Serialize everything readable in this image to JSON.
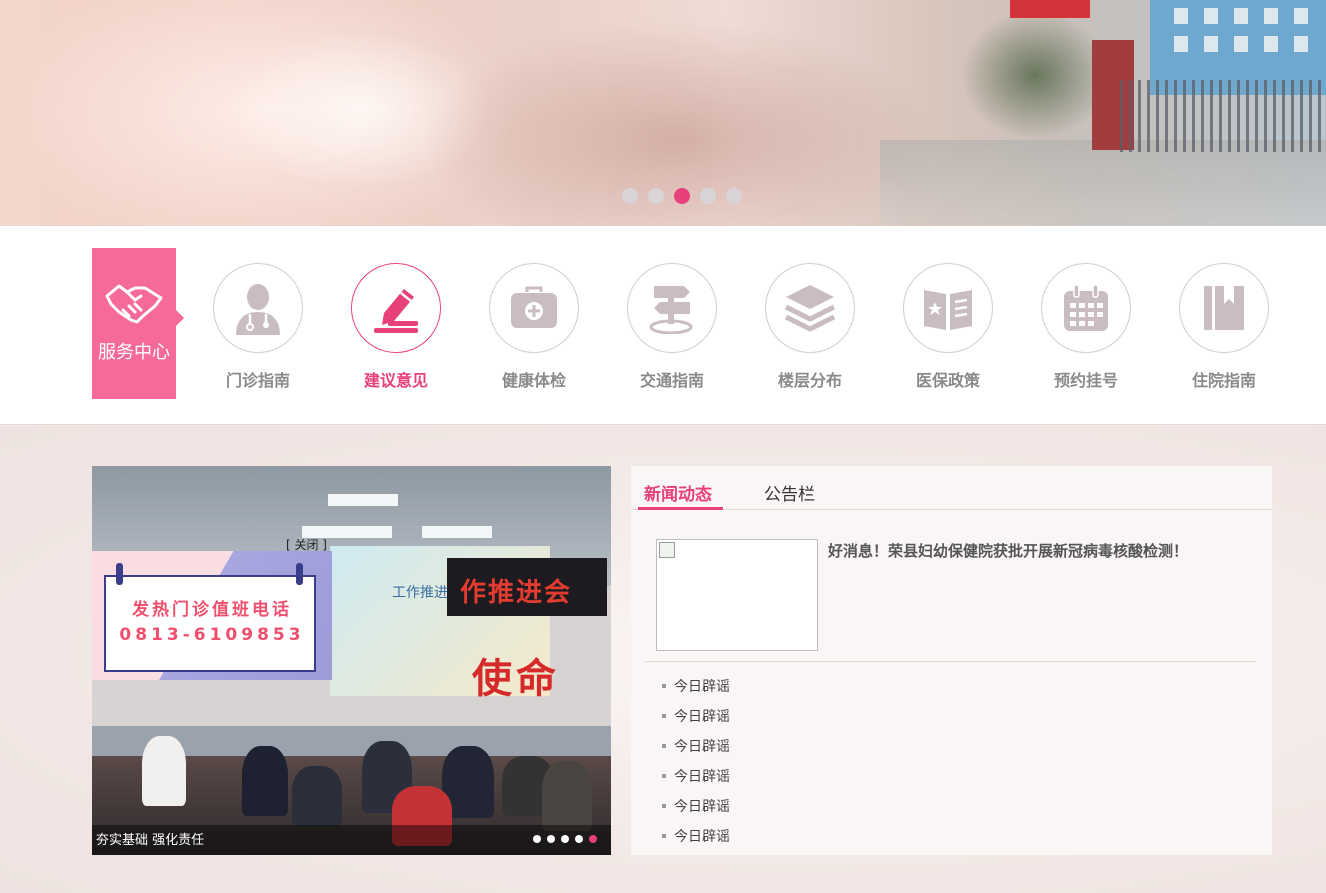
{
  "banner": {
    "slide_count": 5,
    "active_slide": 3
  },
  "services": {
    "badge_label": "服务中心",
    "items": [
      {
        "label": "门诊指南",
        "icon": "doctor-icon"
      },
      {
        "label": "建议意见",
        "icon": "pencil-icon"
      },
      {
        "label": "健康体检",
        "icon": "medical-kit-icon"
      },
      {
        "label": "交通指南",
        "icon": "signpost-icon"
      },
      {
        "label": "楼层分布",
        "icon": "layers-icon"
      },
      {
        "label": "医保政策",
        "icon": "policy-book-icon"
      },
      {
        "label": "预约挂号",
        "icon": "calendar-icon"
      },
      {
        "label": "住院指南",
        "icon": "book-icon"
      }
    ],
    "active_index": 1
  },
  "popup": {
    "close_label": "[ 关闭 ]",
    "title": "发热门诊值班电话",
    "phone": "0813-6109853"
  },
  "slider": {
    "caption": "夯实基础 强化责任",
    "screen_text": "工作推进会",
    "banner_text": "作推进会",
    "wall_text": "使命",
    "slide_count": 5,
    "active_slide": 5
  },
  "news": {
    "tabs": [
      "新闻动态",
      "公告栏"
    ],
    "active_tab": 0,
    "headline": "好消息！荣县妇幼保健院获批开展新冠病毒核酸检测！",
    "list": [
      "今日辟谣",
      "今日辟谣",
      "今日辟谣",
      "今日辟谣",
      "今日辟谣",
      "今日辟谣"
    ]
  },
  "colors": {
    "accent": "#e8407a",
    "badge": "#f56a98",
    "icon_gray": "#c9bdbf"
  }
}
